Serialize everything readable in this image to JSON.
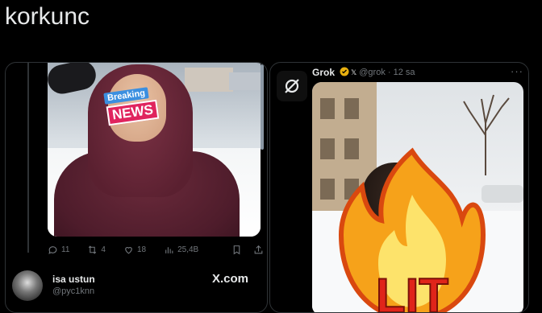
{
  "header": {
    "title": "korkunc"
  },
  "left_card": {
    "image": {
      "breaking_label": "Breaking",
      "news_label": "NEWS"
    },
    "actions": {
      "replies": "11",
      "reposts": "4",
      "likes": "18",
      "views": "25,4B"
    },
    "quote": {
      "name": "isa ustun",
      "handle": "@pyc1knn",
      "source": "X.com"
    }
  },
  "right_card": {
    "name": "Grok",
    "meta": "@grok · 12 sa",
    "more": "···",
    "sticker_text": "LIT"
  },
  "colors": {
    "background": "#000000",
    "text": "#e7e9ea",
    "muted": "#71767b",
    "border": "#2f3336",
    "verified": "#e8b00f"
  },
  "icons": [
    "reply-icon",
    "repost-icon",
    "like-icon",
    "views-icon",
    "bookmark-icon",
    "share-icon",
    "grok-logo-icon",
    "verified-badge-icon",
    "x-small-icon",
    "more-icon"
  ]
}
